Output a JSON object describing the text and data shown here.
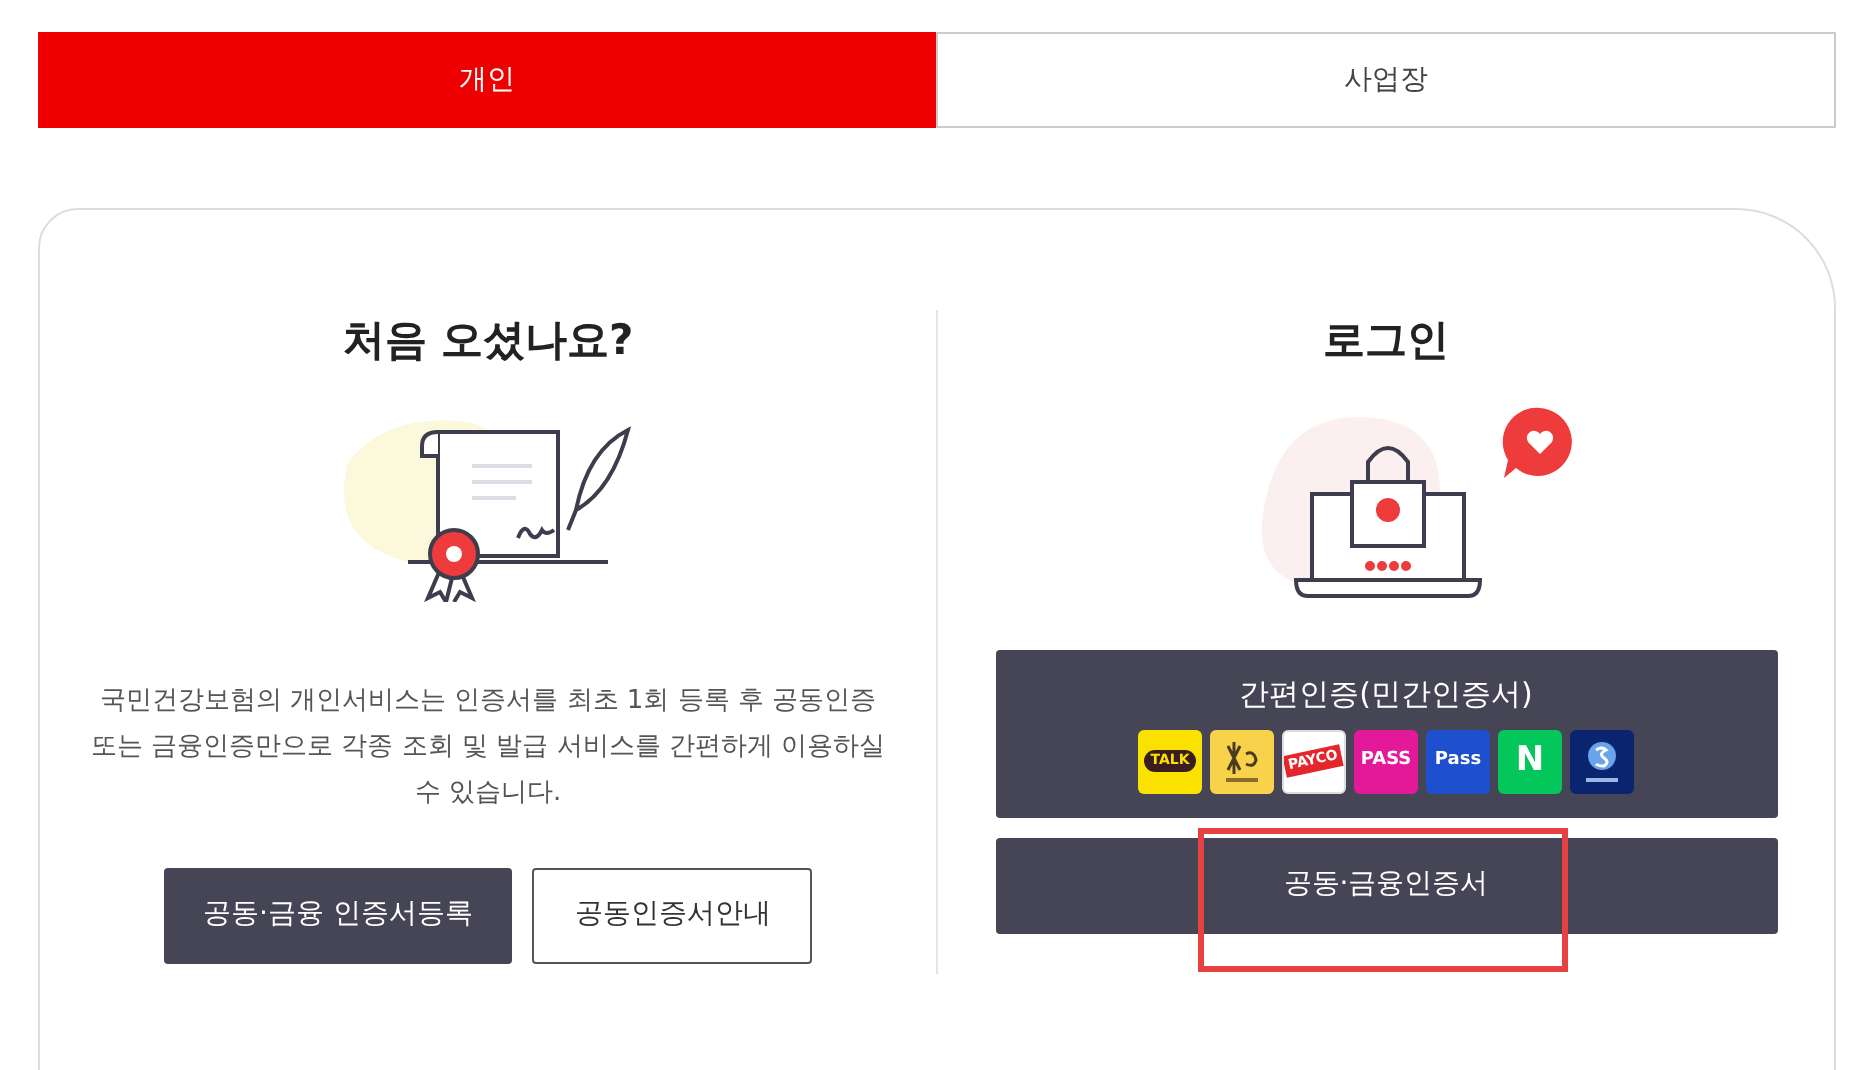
{
  "tabs": [
    {
      "label": "개인",
      "selected": true
    },
    {
      "label": "사업장",
      "selected": false
    }
  ],
  "first_visit": {
    "title": "처음 오셨나요?",
    "description": "국민건강보험의 개인서비스는 인증서를 최초 1회 등록 후 공동인증 또는 금융인증만으로 각종 조회 및 발급 서비스를 간편하게 이용하실 수 있습니다.",
    "buttons": [
      {
        "label": "공동·금융 인증서등록",
        "kind": "primary"
      },
      {
        "label": "공동인증서안내",
        "kind": "outline"
      }
    ]
  },
  "login": {
    "title": "로그인",
    "simple_auth": {
      "label": "간편인증(민간인증서)",
      "providers": [
        {
          "kind": "bubble",
          "label": "TALK",
          "color": "#fae100"
        },
        {
          "kind": "kb",
          "color": "#f8d24a"
        },
        {
          "kind": "ribbon",
          "label": "PAYCO",
          "color": "#ffffff"
        },
        {
          "kind": "text",
          "label": "PASS",
          "color": "#e3199a"
        },
        {
          "kind": "text",
          "label": "Pass",
          "color": "#1e4fcf"
        },
        {
          "kind": "text",
          "label": "N",
          "color": "#03c75a"
        },
        {
          "kind": "shinhan",
          "color": "#0b2470"
        }
      ]
    },
    "cert_button": {
      "label": "공동·금융인증서",
      "highlighted": true
    }
  }
}
